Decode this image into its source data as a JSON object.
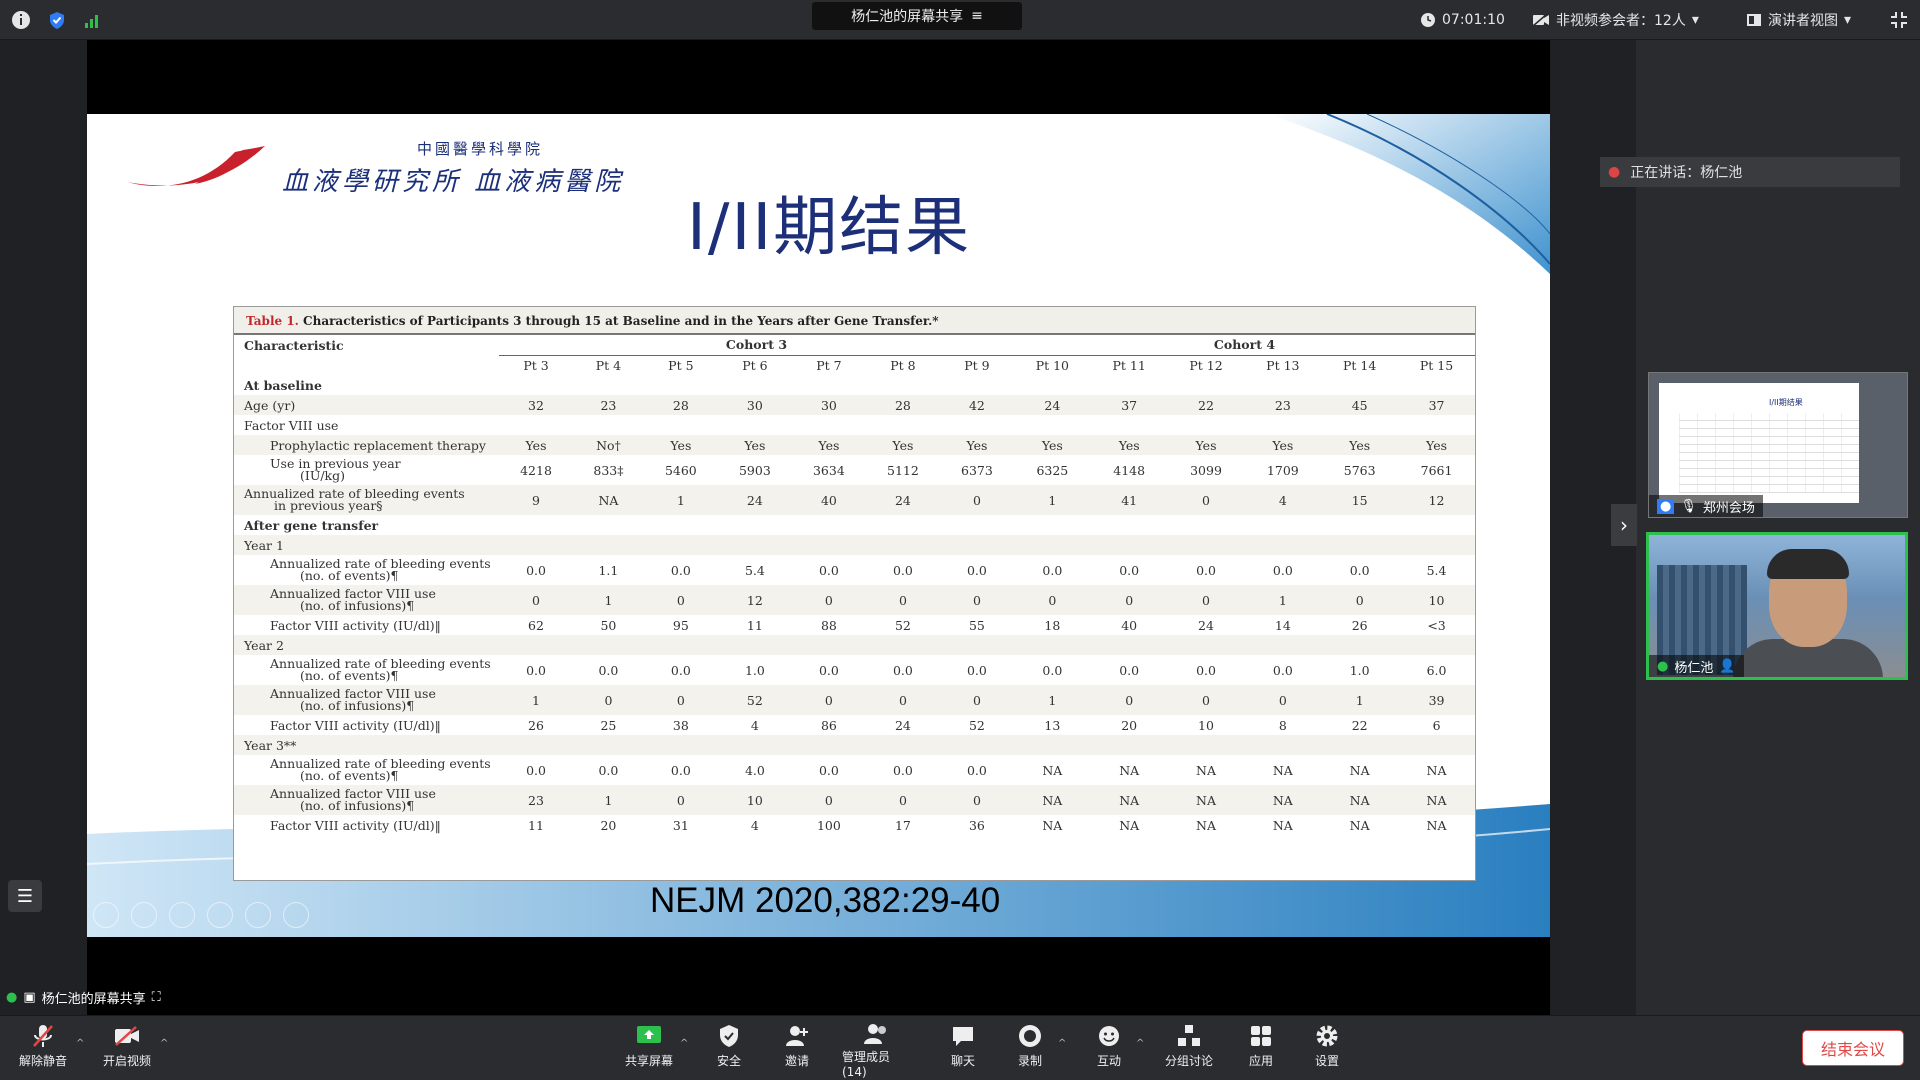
{
  "topbar": {
    "share_title": "杨仁池的屏幕共享",
    "timer": "07:01:10",
    "participants": "非视频参会者：12人",
    "view_label": "演讲者视图"
  },
  "slide": {
    "logo_small": "中國醫學科學院",
    "logo_big": "血液學研究所 血液病醫院",
    "title": "I/II期结果",
    "citation": "NEJM 2020,382:29-40",
    "table": {
      "caption_num": "Table 1.",
      "caption": "Characteristics of Participants 3 through 15 at Baseline and in the Years after Gene Transfer.*",
      "characteristic_header": "Characteristic",
      "cohort3": "Cohort 3",
      "cohort4": "Cohort 4",
      "patients": [
        "Pt 3",
        "Pt 4",
        "Pt 5",
        "Pt 6",
        "Pt 7",
        "Pt 8",
        "Pt 9",
        "Pt 10",
        "Pt 11",
        "Pt 12",
        "Pt 13",
        "Pt 14",
        "Pt 15"
      ],
      "rows": [
        {
          "label": "At baseline",
          "style": "bold",
          "values": []
        },
        {
          "label": "Age (yr)",
          "style": "main",
          "values": [
            "32",
            "23",
            "28",
            "30",
            "30",
            "28",
            "42",
            "24",
            "37",
            "22",
            "23",
            "45",
            "37"
          ]
        },
        {
          "label": "Factor VIII use",
          "style": "main",
          "values": []
        },
        {
          "label": "Prophylactic replacement therapy",
          "style": "sub",
          "values": [
            "Yes",
            "No†",
            "Yes",
            "Yes",
            "Yes",
            "Yes",
            "Yes",
            "Yes",
            "Yes",
            "Yes",
            "Yes",
            "Yes",
            "Yes"
          ]
        },
        {
          "label": "Use in previous year",
          "label2": "(IU/kg)",
          "style": "sub",
          "values": [
            "4218",
            "833‡",
            "5460",
            "5903",
            "3634",
            "5112",
            "6373",
            "6325",
            "4148",
            "3099",
            "1709",
            "5763",
            "7661"
          ]
        },
        {
          "label": "Annualized rate of bleeding events",
          "label2": "in previous year§",
          "style": "main",
          "values": [
            "9",
            "NA",
            "1",
            "24",
            "40",
            "24",
            "0",
            "1",
            "41",
            "0",
            "4",
            "15",
            "12"
          ]
        },
        {
          "label": "After gene transfer",
          "style": "bold",
          "values": []
        },
        {
          "label": "Year 1",
          "style": "main",
          "values": []
        },
        {
          "label": "Annualized rate of bleeding events",
          "label2": "(no. of events)¶",
          "style": "sub",
          "values": [
            "0.0",
            "1.1",
            "0.0",
            "5.4",
            "0.0",
            "0.0",
            "0.0",
            "0.0",
            "0.0",
            "0.0",
            "0.0",
            "0.0",
            "5.4"
          ]
        },
        {
          "label": "Annualized factor VIII use",
          "label2": "(no. of infusions)¶",
          "style": "sub",
          "values": [
            "0",
            "1",
            "0",
            "12",
            "0",
            "0",
            "0",
            "0",
            "0",
            "0",
            "1",
            "0",
            "10"
          ]
        },
        {
          "label": "Factor VIII activity (IU/dl)‖",
          "style": "sub",
          "values": [
            "62",
            "50",
            "95",
            "11",
            "88",
            "52",
            "55",
            "18",
            "40",
            "24",
            "14",
            "26",
            "<3"
          ]
        },
        {
          "label": "Year 2",
          "style": "main",
          "values": []
        },
        {
          "label": "Annualized rate of bleeding events",
          "label2": "(no. of events)¶",
          "style": "sub",
          "values": [
            "0.0",
            "0.0",
            "0.0",
            "1.0",
            "0.0",
            "0.0",
            "0.0",
            "0.0",
            "0.0",
            "0.0",
            "0.0",
            "1.0",
            "6.0"
          ]
        },
        {
          "label": "Annualized factor VIII use",
          "label2": "(no. of infusions)¶",
          "style": "sub",
          "values": [
            "1",
            "0",
            "0",
            "52",
            "0",
            "0",
            "0",
            "1",
            "0",
            "0",
            "0",
            "1",
            "39"
          ]
        },
        {
          "label": "Factor VIII activity (IU/dl)‖",
          "style": "sub",
          "values": [
            "26",
            "25",
            "38",
            "4",
            "86",
            "24",
            "52",
            "13",
            "20",
            "10",
            "8",
            "22",
            "6"
          ]
        },
        {
          "label": "Year 3**",
          "style": "main",
          "values": []
        },
        {
          "label": "Annualized rate of bleeding events",
          "label2": "(no. of events)¶",
          "style": "sub",
          "values": [
            "0.0",
            "0.0",
            "0.0",
            "4.0",
            "0.0",
            "0.0",
            "0.0",
            "NA",
            "NA",
            "NA",
            "NA",
            "NA",
            "NA"
          ]
        },
        {
          "label": "Annualized factor VIII use",
          "label2": "(no. of infusions)¶",
          "style": "sub",
          "values": [
            "23",
            "1",
            "0",
            "10",
            "0",
            "0",
            "0",
            "NA",
            "NA",
            "NA",
            "NA",
            "NA",
            "NA"
          ]
        },
        {
          "label": "Factor VIII activity (IU/dl)‖",
          "style": "sub",
          "values": [
            "11",
            "20",
            "31",
            "4",
            "100",
            "17",
            "36",
            "NA",
            "NA",
            "NA",
            "NA",
            "NA",
            "NA"
          ]
        }
      ]
    }
  },
  "panel": {
    "speaking": "正在讲话：杨仁池",
    "thumb1_label": "郑州会场",
    "thumb2_label": "杨仁池",
    "thumb1_mini_title": "I/II期结果"
  },
  "sharer_label": "杨仁池的屏幕共享",
  "toolbar": {
    "mute": "解除静音",
    "video": "开启视频",
    "share": "共享屏幕",
    "security": "安全",
    "invite": "邀请",
    "members": "管理成员(14)",
    "chat": "聊天",
    "record": "录制",
    "interact": "互动",
    "breakout": "分组讨论",
    "apps": "应用",
    "settings": "设置",
    "end": "结束会议"
  },
  "colors": {
    "accent_green": "#2ec04c",
    "end_red": "#e04848",
    "title_blue": "#1c2f78"
  }
}
